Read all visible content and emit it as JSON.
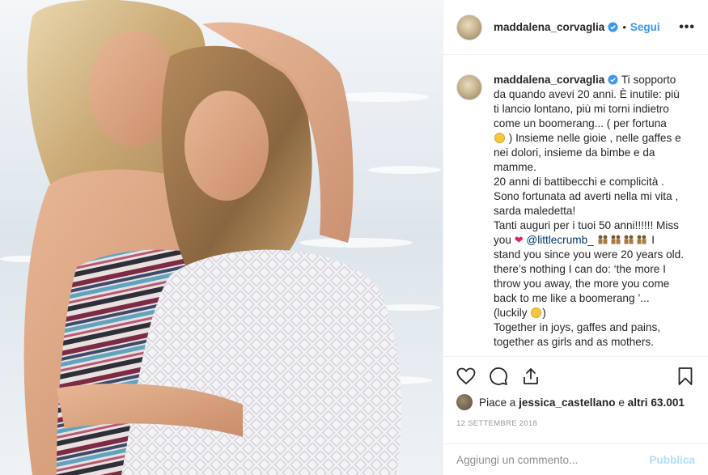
{
  "post": {
    "username": "maddalena_corvaglia",
    "follow_label": "Segui",
    "more_label": "•••",
    "caption_lines": [
      "Ti sopporto",
      "da quando avevi 20 anni. È inutile: più",
      "ti lancio lontano, più mi torni indietro",
      "come un boomerang... ( per fortuna",
      " ) Insieme nelle gioie , nelle gaffes e",
      "nei dolori, insieme da bimbe e da",
      "mamme.",
      "20 anni di battibecchi e complicità .",
      "Sono fortunata ad averti nella mi vita ,",
      "sarda maledetta!",
      "Tanti auguri per i tuoi 50 anni!!!!!! Miss",
      "you",
      "@littlecrumb_",
      "I",
      "stand you since you were 20 years old.",
      "there’s nothing I can do: ‘the more I",
      "throw you away, the more you come",
      "back to me like a boomerang ’...",
      "(luckily",
      ")",
      "Together in joys, gaffes and pains,",
      "together as girls and as mothers."
    ],
    "likes_prefix": "Piace a",
    "likes_user": "jessica_castellano",
    "likes_and": "e",
    "likes_count": "altri 63.001",
    "date": "12 settembre 2018",
    "comment_placeholder": "Aggiungi un commento...",
    "publish_label": "Pubblica",
    "colors": {
      "accent": "#3897f0",
      "publish_disabled": "#b2dffc",
      "heart": "#e0245e"
    },
    "icons": [
      "verified-badge-icon",
      "heart-icon",
      "comment-icon",
      "share-icon",
      "bookmark-icon",
      "more-options-icon"
    ]
  }
}
